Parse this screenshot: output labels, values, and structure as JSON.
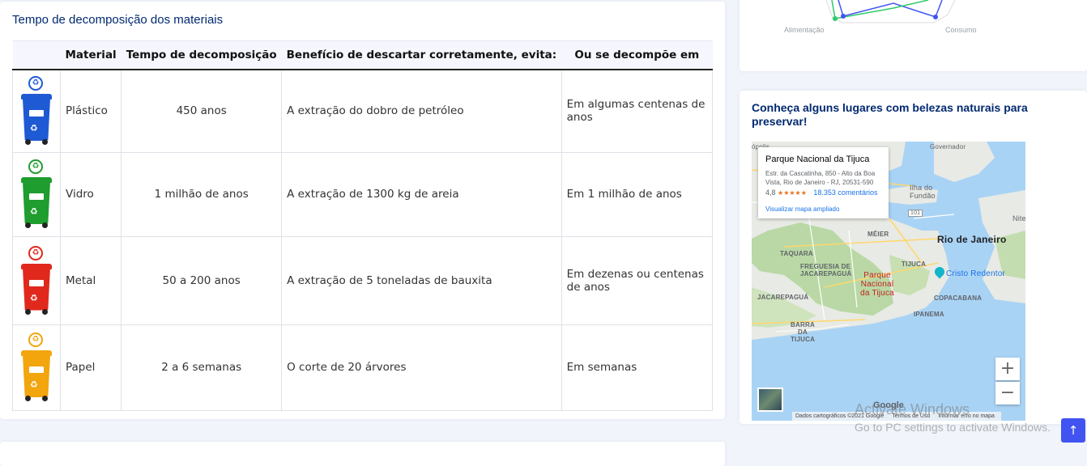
{
  "materials_card": {
    "title": "Tempo de decomposição dos materiais",
    "headers": [
      "",
      "Material",
      "Tempo de decomposição",
      "Benefício de descartar corretamente, evita:",
      "Ou se decompõe em"
    ],
    "rows": [
      {
        "material": "Plástico",
        "time": "450 anos",
        "benefit": "A extração do dobro de petróleo",
        "decomposes_in": "Em algumas centenas de anos",
        "bin_color": "#1e5ad4",
        "bin_icon": "recycle-bin-blue-icon"
      },
      {
        "material": "Vidro",
        "time": "1 milhão de anos",
        "benefit": "A extração de 1300 kg de areia",
        "decomposes_in": "Em 1 milhão de anos",
        "bin_color": "#1f9d2e",
        "bin_icon": "recycle-bin-green-icon"
      },
      {
        "material": "Metal",
        "time": "50 a 200 anos",
        "benefit": "A extração de 5 toneladas de bauxita",
        "decomposes_in": "Em dezenas ou centenas de anos",
        "bin_color": "#e0291c",
        "bin_icon": "recycle-bin-red-icon"
      },
      {
        "material": "Papel",
        "time": "2 a 6 semanas",
        "benefit": "O corte de 20 árvores",
        "decomposes_in": "Em semanas",
        "bin_color": "#f2a50c",
        "bin_icon": "recycle-bin-yellow-icon"
      }
    ]
  },
  "radar_chart": {
    "axis_labels": [
      "Alimentação",
      "Consumo"
    ],
    "series_colors": [
      "#4154f1",
      "#2eca6a"
    ]
  },
  "places_card": {
    "title": "Conheça alguns lugares com belezas naturais para preservar!",
    "map": {
      "info_window": {
        "title": "Parque Nacional da Tijuca",
        "address": "Estr. da Cascatinha, 850 - Alto da Boa Vista, Rio de Janeiro - RJ, 20531-590",
        "rating": "4,8",
        "stars": "★★★★★",
        "reviews": "18.353 comentários",
        "link": "Visualizar mapa ampliado"
      },
      "labels": {
        "governador": "Governador",
        "opolis": "ópolis",
        "ilha_do_fundao": "Ilha do Fundão",
        "route_101": "101",
        "niteroi": "Nite",
        "meier": "MÉIER",
        "rio": "Rio de Janeiro",
        "taquara": "TAQUARA",
        "freguesia": "FREGUESIA DE JACAREPAGUÁ",
        "tijuca": "TIJUCA",
        "park": "Parque Nacional da Tijuca",
        "cristo": "Cristo Redentor",
        "jacarepagua": "JACAREPAGUÁ",
        "copacabana": "COPACABANA",
        "ipanema": "IPANEMA",
        "barra": "BARRA DA TIJUCA"
      },
      "zoom_in": "+",
      "zoom_out": "−",
      "google": "Google",
      "footer": [
        "Dados cartográficos ©2021 Google",
        "Termos de Uso",
        "Informar erro no mapa"
      ]
    }
  },
  "overlay": {
    "activate_line1": "Activate Windows",
    "activate_line2": "Go to PC settings to activate Windows.",
    "back_to_top": "↑"
  }
}
